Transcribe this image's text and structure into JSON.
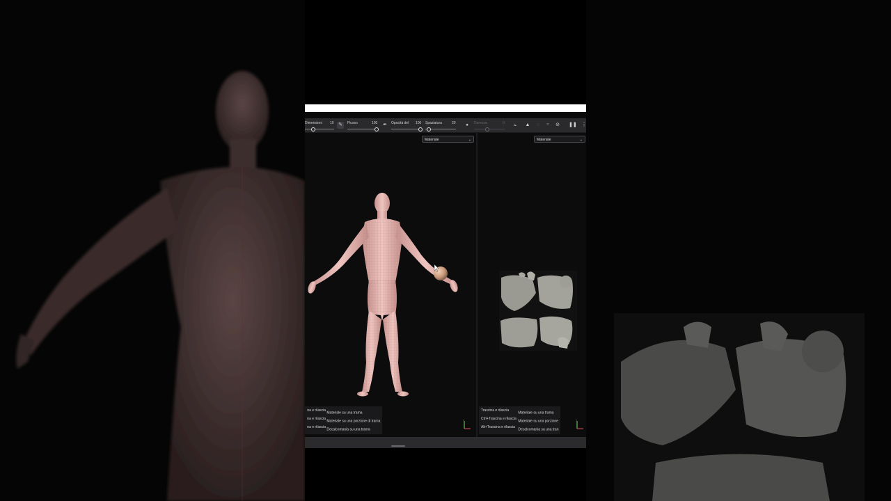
{
  "toolbar": {
    "size_label": "Dimensioni",
    "size_value": "10",
    "flow_label": "Flusso",
    "flow_value": "100",
    "opacity_label": "Opacità del",
    "opacity_value": "100",
    "spacing_label": "Spaziatura",
    "spacing_value": "20",
    "hardness_label": "Durezza",
    "hardness_value": "0"
  },
  "left_viewport": {
    "mode_select": "Materiale",
    "hints": [
      {
        "key": "Trascina e rilascia",
        "action": "Materiale su una trama"
      },
      {
        "key": "Ctrl+Trascina e rilascia",
        "action": "Materiale su una porzione di trama"
      },
      {
        "key": "Alt+Trascina e rilascia",
        "action": "Decalcomania su una trama"
      }
    ]
  },
  "right_viewport": {
    "mode_select": "Materiale",
    "hints": [
      {
        "key": "Trascina e rilascia",
        "action": "Materiale su una trama"
      },
      {
        "key": "Ctrl+Trascina e rilascia",
        "action": "Materiale su una porzione"
      },
      {
        "key": "Alt+Trascina e rilascia",
        "action": "Decalcomania su una tran"
      }
    ]
  },
  "colors": {
    "app_bg": "#0b0b0c",
    "toolbar_bg": "#2a2a2d",
    "model_skin": "#e8b8b4"
  },
  "icons": [
    "brush-icon",
    "pen-icon",
    "pressure-icon",
    "symmetry-icon",
    "lazy-mouse-icon",
    "crop-icon",
    "hide-icon",
    "pause-icon",
    "axis-gizmo-icon"
  ]
}
